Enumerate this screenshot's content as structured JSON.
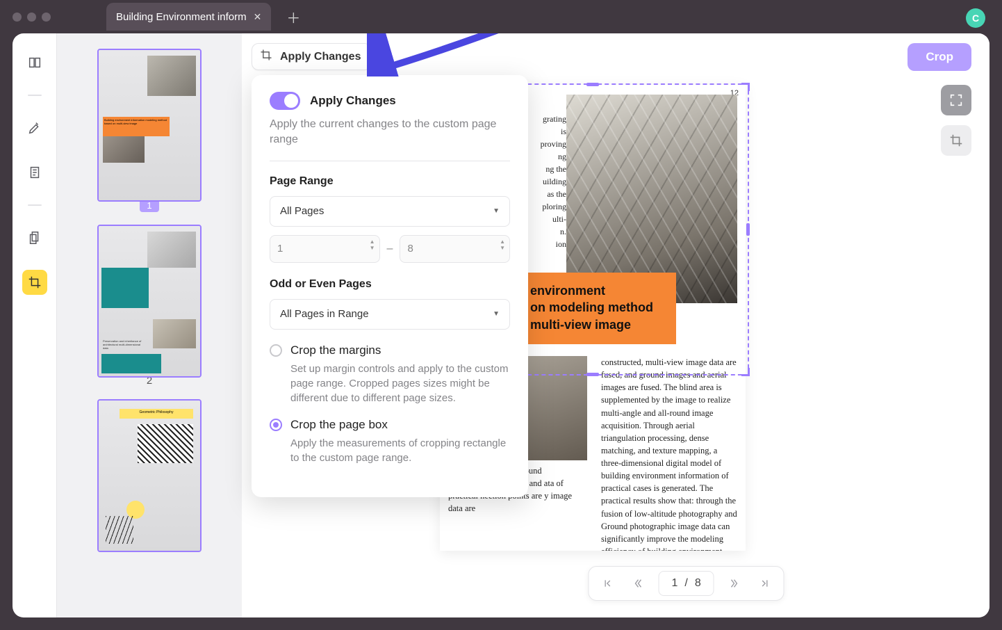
{
  "window": {
    "tab_title": "Building Environment inform",
    "avatar_initial": "C"
  },
  "toolbar": {
    "apply_changes_label": "Apply Changes",
    "crop_button": "Crop"
  },
  "popover": {
    "apply_title": "Apply Changes",
    "apply_desc": "Apply the current changes to the custom page range",
    "page_range_heading": "Page Range",
    "page_range_select": "All Pages",
    "range_from": "1",
    "range_to": "8",
    "odd_even_heading": "Odd or Even Pages",
    "odd_even_select": "All Pages in Range",
    "radio_margins_title": "Crop the margins",
    "radio_margins_desc": "Set up margin controls and apply to the custom page range. Cropped pages sizes might be different due to different page sizes.",
    "radio_box_title": "Crop the page box",
    "radio_box_desc": "Apply the measurements of cropping rectangle to the custom page range."
  },
  "thumbnails": {
    "labels": [
      "1",
      "2"
    ],
    "t1_overlay": "Building environment information modeling method based on multi-view image",
    "t2_overlay": "Preservation and inheritance of architectural multi-dimensional data",
    "t3_overlay": "Geometric Philosophy"
  },
  "page": {
    "page_number": "12",
    "orange_title_1": "environment",
    "orange_title_2": "on modeling method",
    "orange_title_3": "multi-view image",
    "body_right": "constructed, multi-view image data are fused, and ground images and aerial images are fused. The blind area is supplemented by the image to realize multi-angle and all-round image acquisition. Through aerial triangulation processing, dense matching, and texture mapping, a three-dimensional digital model of building environment information of practical cases is generated. The practical results show that: through the fusion of low-altitude photography and Ground photographic image data can significantly improve the modeling efficiency of building environment information and the modeling accuracy of building detail information, solve the problem of incomplete information",
    "body_left": "d cases, low-altitude round photography hitectural and ata of practical nection points are y image data are",
    "left_blurb_lines": [
      "grating",
      "is",
      "proving",
      "ng",
      "ng the",
      "uilding",
      "as the",
      "ploring",
      "ulti-",
      "n.",
      "ion"
    ]
  },
  "pager": {
    "current": "1",
    "sep": "/",
    "total": "8"
  }
}
